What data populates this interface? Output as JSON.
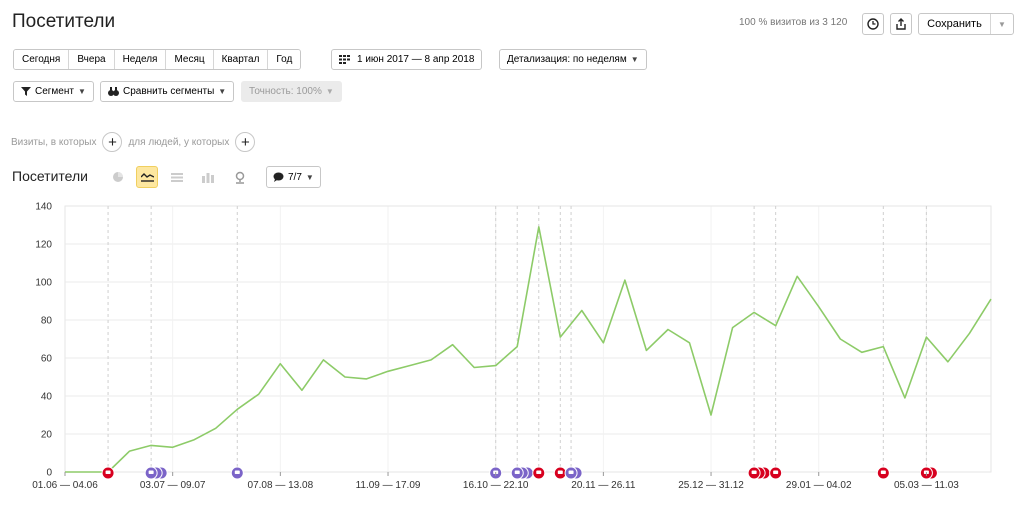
{
  "header": {
    "title": "Посетители",
    "visits_info": "100 % визитов из 3 120",
    "save_label": "Сохранить"
  },
  "periods": [
    "Сегодня",
    "Вчера",
    "Неделя",
    "Месяц",
    "Квартал",
    "Год"
  ],
  "date_range": "1 июн 2017 — 8 апр 2018",
  "detail": "Детализация: по неделям",
  "segment_label": "Сегмент",
  "compare_label": "Сравнить сегменты",
  "accuracy_label": "Точность: 100%",
  "filters": {
    "visits_label": "Визиты, в которых",
    "people_label": "для людей, у которых"
  },
  "chart_section": {
    "title": "Посетители",
    "notes_count": "7/7"
  },
  "colors": {
    "line": "#8dcb68",
    "accent": "#fde7a0",
    "note_purple": "#7b64c8",
    "note_red": "#d7001f"
  },
  "chart_data": {
    "type": "line",
    "title": "",
    "xlabel": "",
    "ylabel": "",
    "ylim": [
      0,
      140
    ],
    "yticks": [
      0,
      20,
      40,
      60,
      80,
      100,
      120,
      140
    ],
    "xtick_labels": [
      "01.06 — 04.06",
      "03.07 — 09.07",
      "07.08 — 13.08",
      "11.09 — 17.09",
      "16.10 — 22.10",
      "20.11 — 26.11",
      "25.12 — 31.12",
      "29.01 — 04.02",
      "05.03 — 11.03"
    ],
    "grid": true,
    "series": [
      {
        "values": [
          0,
          0,
          0,
          11,
          14,
          13,
          17,
          23,
          33,
          41,
          57,
          43,
          59,
          50,
          49,
          53,
          56,
          59,
          67,
          55,
          56,
          66,
          129,
          71,
          85,
          68,
          101,
          64,
          75,
          68,
          30,
          76,
          84,
          77,
          103,
          87,
          70,
          63,
          66,
          39,
          71,
          58,
          73,
          91
        ]
      }
    ],
    "annotations": [
      {
        "week": 2,
        "color": "red",
        "count": 1
      },
      {
        "week": 4,
        "color": "purple",
        "count": 3
      },
      {
        "week": 8,
        "color": "purple",
        "count": 1
      },
      {
        "week": 20,
        "color": "purple",
        "count": 1
      },
      {
        "week": 21,
        "color": "purple",
        "count": 3
      },
      {
        "week": 22,
        "color": "red",
        "count": 1
      },
      {
        "week": 23,
        "color": "red",
        "count": 1
      },
      {
        "week": 23.5,
        "color": "purple",
        "count": 2
      },
      {
        "week": 32,
        "color": "red",
        "count": 3
      },
      {
        "week": 33,
        "color": "red",
        "count": 1
      },
      {
        "week": 38,
        "color": "red",
        "count": 1
      },
      {
        "week": 40,
        "color": "red",
        "count": 2
      }
    ]
  }
}
